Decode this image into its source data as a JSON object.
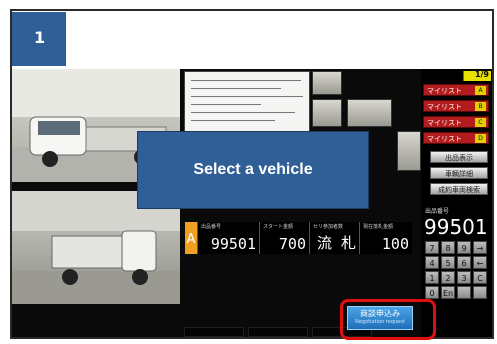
{
  "step": {
    "number": "1"
  },
  "dialog": {
    "label": "Select a vehicle"
  },
  "info_bar": {
    "lot_letter": "A",
    "cells": [
      {
        "caption": "出品番号",
        "value": "99501"
      },
      {
        "caption": "スタート金額",
        "value": "700"
      },
      {
        "caption": "セリ参加者数",
        "value": "流 札"
      },
      {
        "caption": "現在落札金額",
        "value": "100"
      }
    ]
  },
  "side_panel": {
    "bid_value": "1/9",
    "red_buttons": [
      {
        "label": "マイリスト",
        "tag": "A"
      },
      {
        "label": "マイリスト",
        "tag": "B"
      },
      {
        "label": "マイリスト",
        "tag": "C"
      },
      {
        "label": "マイリスト",
        "tag": "D"
      }
    ],
    "gray_buttons": [
      "出品表示",
      "車輌詳細",
      "成約車両検索"
    ],
    "lot_label": "出品番号",
    "lot_number": "99501",
    "keypad": [
      "7",
      "8",
      "9",
      "→",
      "4",
      "5",
      "6",
      "←",
      "1",
      "2",
      "3",
      "C",
      "0",
      "En",
      "",
      ""
    ]
  },
  "apply_button": {
    "label": "商談申込み",
    "sub": "Negotiation request"
  },
  "colors": {
    "accent": "#2f5f96",
    "highlight": "#e10f0f",
    "apply": "#1f6fb8"
  }
}
